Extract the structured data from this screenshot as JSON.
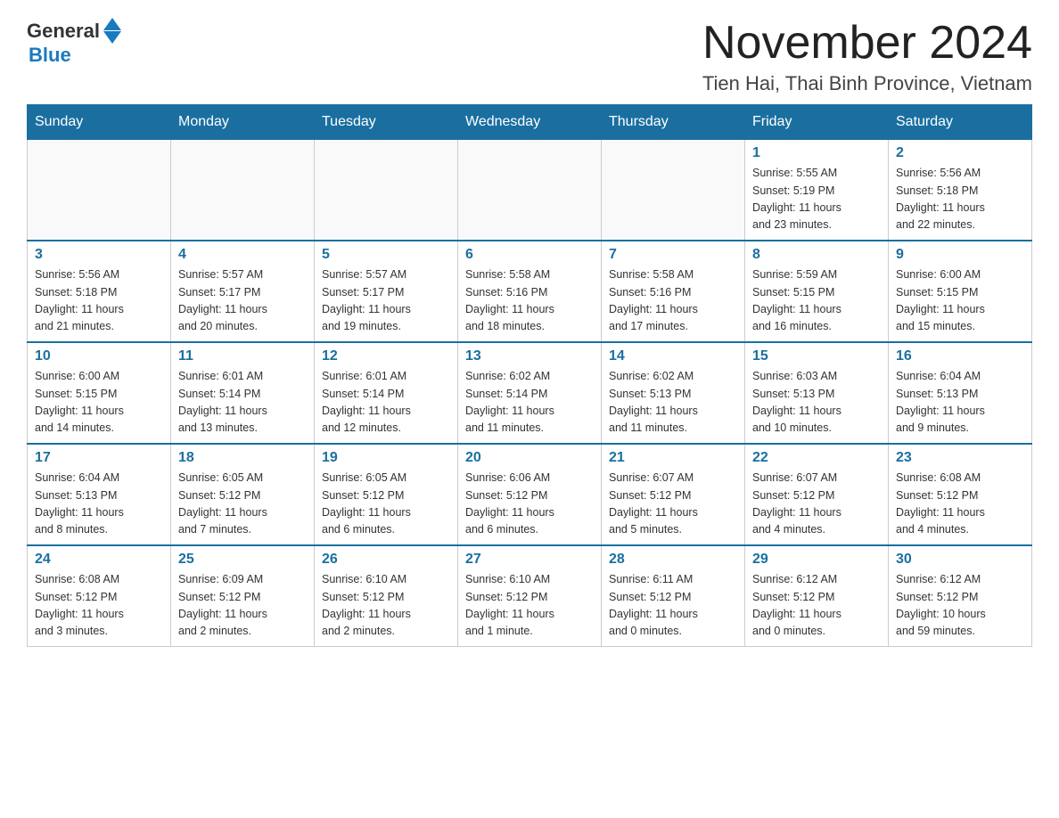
{
  "header": {
    "logo": {
      "general": "General",
      "blue": "Blue"
    },
    "title": "November 2024",
    "location": "Tien Hai, Thai Binh Province, Vietnam"
  },
  "days_of_week": [
    "Sunday",
    "Monday",
    "Tuesday",
    "Wednesday",
    "Thursday",
    "Friday",
    "Saturday"
  ],
  "weeks": [
    {
      "days": [
        {
          "number": "",
          "detail": ""
        },
        {
          "number": "",
          "detail": ""
        },
        {
          "number": "",
          "detail": ""
        },
        {
          "number": "",
          "detail": ""
        },
        {
          "number": "",
          "detail": ""
        },
        {
          "number": "1",
          "detail": "Sunrise: 5:55 AM\nSunset: 5:19 PM\nDaylight: 11 hours\nand 23 minutes."
        },
        {
          "number": "2",
          "detail": "Sunrise: 5:56 AM\nSunset: 5:18 PM\nDaylight: 11 hours\nand 22 minutes."
        }
      ]
    },
    {
      "days": [
        {
          "number": "3",
          "detail": "Sunrise: 5:56 AM\nSunset: 5:18 PM\nDaylight: 11 hours\nand 21 minutes."
        },
        {
          "number": "4",
          "detail": "Sunrise: 5:57 AM\nSunset: 5:17 PM\nDaylight: 11 hours\nand 20 minutes."
        },
        {
          "number": "5",
          "detail": "Sunrise: 5:57 AM\nSunset: 5:17 PM\nDaylight: 11 hours\nand 19 minutes."
        },
        {
          "number": "6",
          "detail": "Sunrise: 5:58 AM\nSunset: 5:16 PM\nDaylight: 11 hours\nand 18 minutes."
        },
        {
          "number": "7",
          "detail": "Sunrise: 5:58 AM\nSunset: 5:16 PM\nDaylight: 11 hours\nand 17 minutes."
        },
        {
          "number": "8",
          "detail": "Sunrise: 5:59 AM\nSunset: 5:15 PM\nDaylight: 11 hours\nand 16 minutes."
        },
        {
          "number": "9",
          "detail": "Sunrise: 6:00 AM\nSunset: 5:15 PM\nDaylight: 11 hours\nand 15 minutes."
        }
      ]
    },
    {
      "days": [
        {
          "number": "10",
          "detail": "Sunrise: 6:00 AM\nSunset: 5:15 PM\nDaylight: 11 hours\nand 14 minutes."
        },
        {
          "number": "11",
          "detail": "Sunrise: 6:01 AM\nSunset: 5:14 PM\nDaylight: 11 hours\nand 13 minutes."
        },
        {
          "number": "12",
          "detail": "Sunrise: 6:01 AM\nSunset: 5:14 PM\nDaylight: 11 hours\nand 12 minutes."
        },
        {
          "number": "13",
          "detail": "Sunrise: 6:02 AM\nSunset: 5:14 PM\nDaylight: 11 hours\nand 11 minutes."
        },
        {
          "number": "14",
          "detail": "Sunrise: 6:02 AM\nSunset: 5:13 PM\nDaylight: 11 hours\nand 11 minutes."
        },
        {
          "number": "15",
          "detail": "Sunrise: 6:03 AM\nSunset: 5:13 PM\nDaylight: 11 hours\nand 10 minutes."
        },
        {
          "number": "16",
          "detail": "Sunrise: 6:04 AM\nSunset: 5:13 PM\nDaylight: 11 hours\nand 9 minutes."
        }
      ]
    },
    {
      "days": [
        {
          "number": "17",
          "detail": "Sunrise: 6:04 AM\nSunset: 5:13 PM\nDaylight: 11 hours\nand 8 minutes."
        },
        {
          "number": "18",
          "detail": "Sunrise: 6:05 AM\nSunset: 5:12 PM\nDaylight: 11 hours\nand 7 minutes."
        },
        {
          "number": "19",
          "detail": "Sunrise: 6:05 AM\nSunset: 5:12 PM\nDaylight: 11 hours\nand 6 minutes."
        },
        {
          "number": "20",
          "detail": "Sunrise: 6:06 AM\nSunset: 5:12 PM\nDaylight: 11 hours\nand 6 minutes."
        },
        {
          "number": "21",
          "detail": "Sunrise: 6:07 AM\nSunset: 5:12 PM\nDaylight: 11 hours\nand 5 minutes."
        },
        {
          "number": "22",
          "detail": "Sunrise: 6:07 AM\nSunset: 5:12 PM\nDaylight: 11 hours\nand 4 minutes."
        },
        {
          "number": "23",
          "detail": "Sunrise: 6:08 AM\nSunset: 5:12 PM\nDaylight: 11 hours\nand 4 minutes."
        }
      ]
    },
    {
      "days": [
        {
          "number": "24",
          "detail": "Sunrise: 6:08 AM\nSunset: 5:12 PM\nDaylight: 11 hours\nand 3 minutes."
        },
        {
          "number": "25",
          "detail": "Sunrise: 6:09 AM\nSunset: 5:12 PM\nDaylight: 11 hours\nand 2 minutes."
        },
        {
          "number": "26",
          "detail": "Sunrise: 6:10 AM\nSunset: 5:12 PM\nDaylight: 11 hours\nand 2 minutes."
        },
        {
          "number": "27",
          "detail": "Sunrise: 6:10 AM\nSunset: 5:12 PM\nDaylight: 11 hours\nand 1 minute."
        },
        {
          "number": "28",
          "detail": "Sunrise: 6:11 AM\nSunset: 5:12 PM\nDaylight: 11 hours\nand 0 minutes."
        },
        {
          "number": "29",
          "detail": "Sunrise: 6:12 AM\nSunset: 5:12 PM\nDaylight: 11 hours\nand 0 minutes."
        },
        {
          "number": "30",
          "detail": "Sunrise: 6:12 AM\nSunset: 5:12 PM\nDaylight: 10 hours\nand 59 minutes."
        }
      ]
    }
  ]
}
